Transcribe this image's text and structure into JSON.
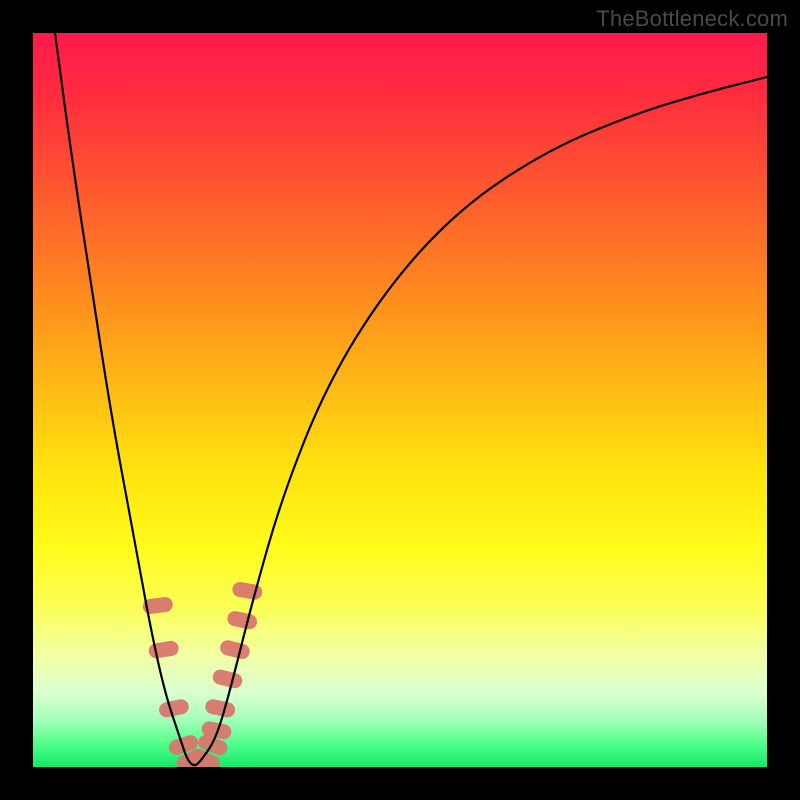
{
  "watermark": "TheBottleneck.com",
  "chart_data": {
    "type": "line",
    "title": "",
    "xlabel": "",
    "ylabel": "",
    "xlim": [
      0,
      100
    ],
    "ylim": [
      0,
      100
    ],
    "curve": {
      "name": "bottleneck-curve",
      "x": [
        3,
        5,
        8,
        11,
        14,
        16,
        18,
        20,
        21,
        22,
        23,
        25,
        27,
        30,
        34,
        40,
        48,
        58,
        70,
        82,
        92,
        100
      ],
      "y": [
        100,
        85,
        65,
        46,
        30,
        19,
        10,
        4,
        1,
        0,
        1,
        4,
        11,
        23,
        37,
        52,
        65,
        76,
        84,
        89,
        92,
        94
      ]
    },
    "markers": {
      "name": "data-points",
      "color": "#d7776e",
      "x": [
        17.0,
        17.8,
        19.2,
        20.5,
        21.5,
        22.0,
        23.0,
        23.5,
        24.5,
        25.0,
        25.5,
        26.5,
        27.5,
        28.5,
        29.2
      ],
      "y": [
        22.0,
        16.0,
        8.0,
        3.0,
        1.0,
        0.0,
        0.0,
        1.0,
        3.0,
        5.0,
        8.0,
        12.0,
        16.0,
        20.0,
        24.0
      ]
    }
  }
}
